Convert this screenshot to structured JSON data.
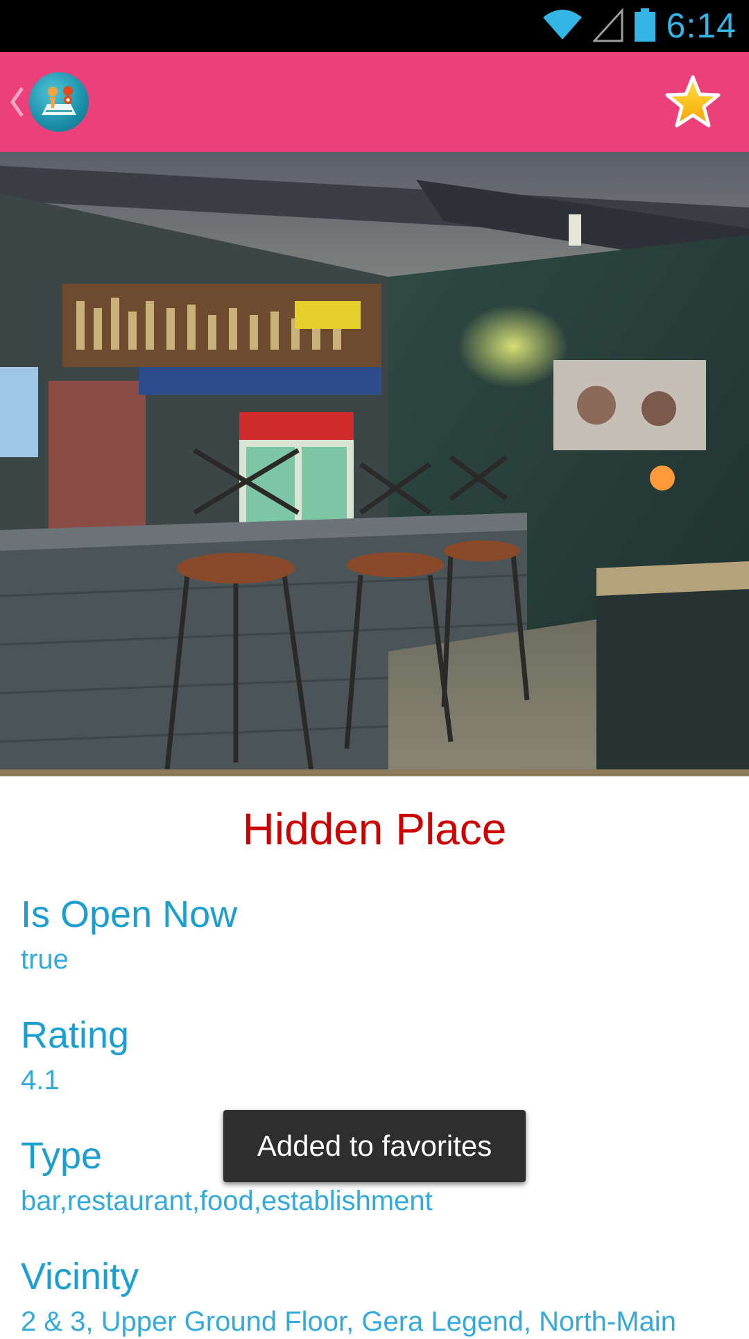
{
  "status_bar": {
    "time": "6:14",
    "icons": [
      "wifi-icon",
      "cell-signal-icon",
      "battery-icon"
    ],
    "accent_color": "#33b5e5"
  },
  "action_bar": {
    "background_color": "#ec407a",
    "back_icon": "chevron-left-icon",
    "app_icon": "map-pin-app-icon",
    "favorite_icon": "star-icon"
  },
  "place": {
    "name": "Hidden Place",
    "title_color": "#cc0000",
    "fields": [
      {
        "label": "Is Open Now",
        "value": "true"
      },
      {
        "label": "Rating",
        "value": "4.1"
      },
      {
        "label": "Type",
        "value": "bar,restaurant,food,establishment"
      },
      {
        "label": "Vicinity",
        "value": "2 & 3, Upper Ground Floor, Gera Legend, North-Main"
      }
    ]
  },
  "toast": {
    "message": "Added to favorites"
  }
}
